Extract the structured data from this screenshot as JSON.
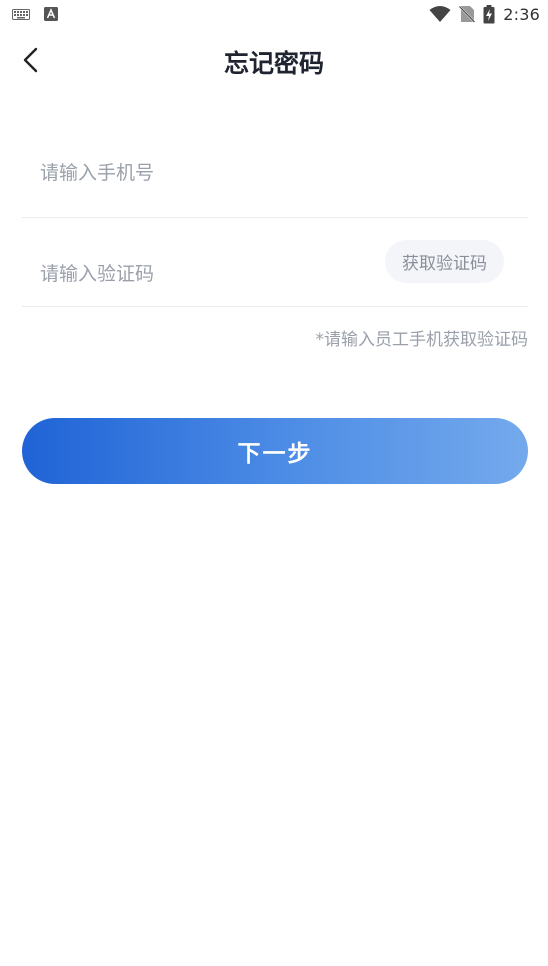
{
  "status_bar": {
    "time": "2:36",
    "icons": [
      "keyboard-icon",
      "a-notification-icon",
      "wifi-icon",
      "no-sim-icon",
      "battery-charging-icon"
    ]
  },
  "header": {
    "title": "忘记密码",
    "back_icon": "chevron-left-icon"
  },
  "form": {
    "phone": {
      "placeholder": "请输入手机号",
      "value": ""
    },
    "code": {
      "placeholder": "请输入验证码",
      "value": ""
    },
    "get_code_label": "获取验证码",
    "hint": "*请输入员工手机获取验证码"
  },
  "actions": {
    "next_label": "下一步"
  },
  "colors": {
    "accent_start": "#1f63d6",
    "accent_end": "#74a9ec",
    "placeholder": "#9aa0aa",
    "title": "#1f2430"
  }
}
